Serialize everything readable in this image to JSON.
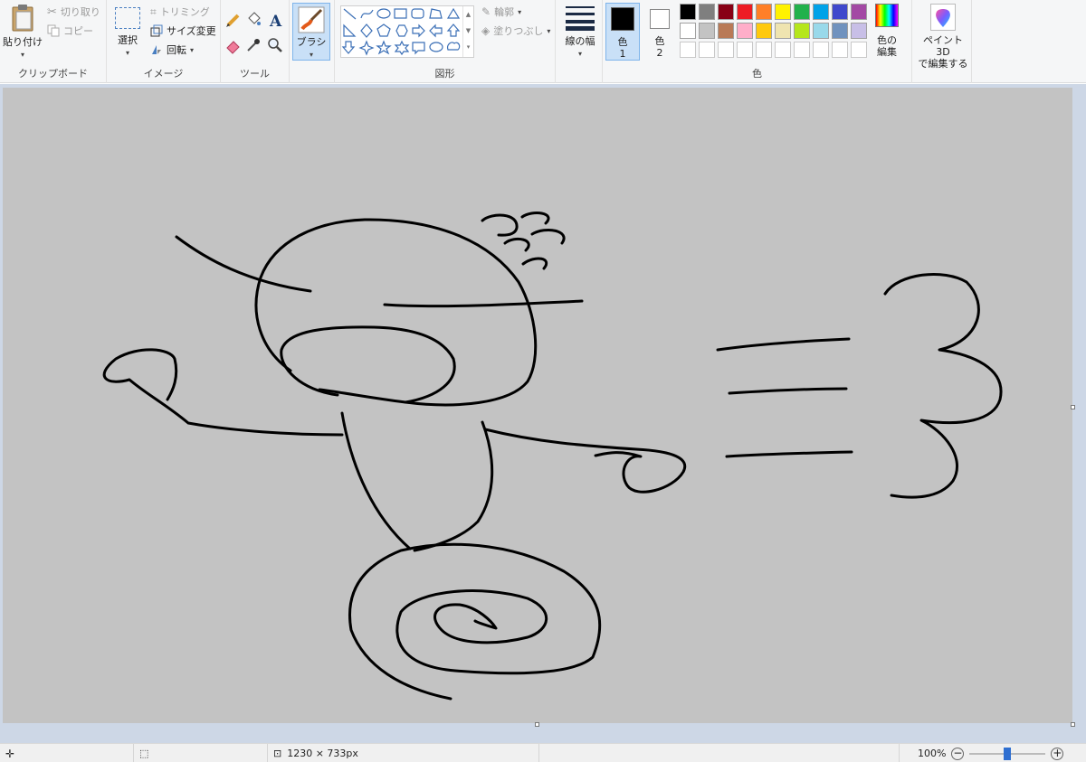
{
  "clipboard": {
    "paste_label": "貼り付け",
    "cut_label": "切り取り",
    "copy_label": "コピー",
    "group_label": "クリップボード"
  },
  "image": {
    "select_label": "選択",
    "crop_label": "トリミング",
    "resize_label": "サイズ変更",
    "rotate_label": "回転",
    "group_label": "イメージ"
  },
  "tools": {
    "group_label": "ツール"
  },
  "brushes": {
    "label": "ブラシ"
  },
  "shapes": {
    "outline_label": "輪郭",
    "fill_label": "塗りつぶし",
    "group_label": "図形"
  },
  "size": {
    "label": "線の幅"
  },
  "colors": {
    "color1_label": "色",
    "color1_num": "1",
    "color2_label": "色",
    "color2_num": "2",
    "edit_label_1": "色の",
    "edit_label_2": "編集",
    "group_label": "色",
    "color1_value": "#000000",
    "color2_value": "#ffffff",
    "palette_row1": [
      "#000000",
      "#7f7f7f",
      "#880015",
      "#ed1c24",
      "#ff7f27",
      "#fff200",
      "#22b14c",
      "#00a2e8",
      "#3f48cc",
      "#a349a4"
    ],
    "palette_row2": [
      "#ffffff",
      "#c3c3c3",
      "#b97a57",
      "#ffaec9",
      "#ffc90e",
      "#efe4b0",
      "#b5e61d",
      "#99d9ea",
      "#7092be",
      "#c8bfe7"
    ]
  },
  "paint3d": {
    "label_1": "ペイント 3D",
    "label_2": "で編集する"
  },
  "canvas": {
    "background": "#c3c3c3"
  },
  "status": {
    "dimensions": "1230 × 733px",
    "zoom": "100%",
    "zoom_fraction": 0.5
  }
}
